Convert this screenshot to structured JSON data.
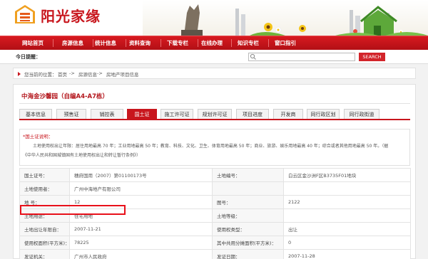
{
  "header": {
    "site_name": "阳光家缘"
  },
  "nav": {
    "items": [
      "网站首页",
      "房源信息",
      "统计信息",
      "资料查询",
      "下载专栏",
      "在线办理",
      "知识专栏",
      "窗口指引"
    ]
  },
  "toolbar": {
    "today_label": "今日提醒：",
    "search_placeholder": "",
    "search_button": "SEARCH"
  },
  "breadcrumb": {
    "prefix": "您当前的位置：",
    "items": [
      "首页",
      "房源信息",
      "房地产项目信息"
    ],
    "separator": "->"
  },
  "project": {
    "title": "中海金沙馨园（自编A4-A7栋）"
  },
  "tabs": [
    {
      "label": "基本信息",
      "active": false
    },
    {
      "label": "预售证",
      "active": false
    },
    {
      "label": "销控表",
      "active": false
    },
    {
      "label": "国土证",
      "active": true
    },
    {
      "label": "施工许可证",
      "active": false
    },
    {
      "label": "规划许可证",
      "active": false
    },
    {
      "label": "项目进度",
      "active": false
    },
    {
      "label": "开发商",
      "active": false
    },
    {
      "label": "同行政区划",
      "active": false
    },
    {
      "label": "同行政街道",
      "active": false
    }
  ],
  "notice": {
    "heading": "*国土证说明：",
    "line1": "土地使用权出让年限：居住用地最高 70 年；工业用地最高 50 年；教育、科技、文化、卫生、体育用地最高 50 年；商业、旅游、娱乐用地最高 40 年；综合或者其他用地最高 50 年。（据",
    "line2": "《中华人民共和国城镇国有土地使用权出让和转让暂行条例》）"
  },
  "land_cert": {
    "rows": [
      {
        "l1": "国土证号：",
        "v1": "穗府国用（2007）第01100173号",
        "l2": "土地编号：",
        "v2": "白云区金沙洲F区B3735F01地块"
      },
      {
        "l1": "土地使用者：",
        "v1": "广州中海地产有限公司",
        "l2": "",
        "v2": ""
      },
      {
        "l1": "地    号：",
        "v1": "12",
        "l2": "图号：",
        "v2": "2122"
      },
      {
        "l1": "土地用途：",
        "v1": "住宅用地",
        "l2": "土地等级：",
        "v2": ""
      },
      {
        "l1": "土地出让年限自：",
        "v1": "2007-11-21",
        "l2": "使用权类型：",
        "v2": "出让"
      },
      {
        "l1": "使用权面积(平方米)：",
        "v1": "78225",
        "l2": "其中共用分摊面积(平方米)：",
        "v2": "0"
      },
      {
        "l1": "发证机关：",
        "v1": "广州市人民政府",
        "l2": "发证日期：",
        "v2": "2007-11-28"
      }
    ]
  }
}
